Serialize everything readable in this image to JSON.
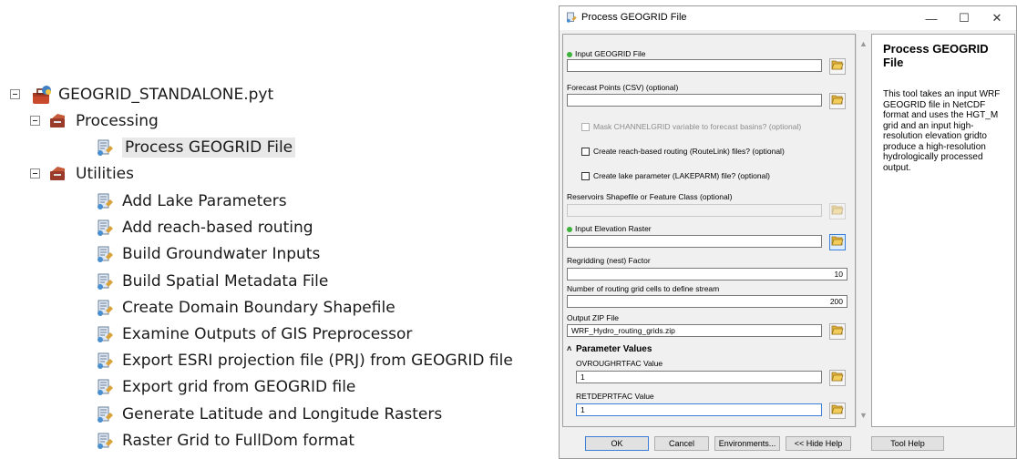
{
  "tree": {
    "toolbox": "GEOGRID_STANDALONE.pyt",
    "toolsets": [
      {
        "label": "Processing",
        "tools": [
          "Process GEOGRID File"
        ]
      },
      {
        "label": "Utilities",
        "tools": [
          "Add Lake Parameters",
          "Add reach-based routing",
          "Build Groundwater Inputs",
          "Build Spatial Metadata File",
          "Create Domain Boundary Shapefile",
          "Examine Outputs of GIS Preprocessor",
          "Export ESRI projection file (PRJ) from GEOGRID file",
          "Export grid from GEOGRID file",
          "Generate Latitude and Longitude Rasters",
          "Raster Grid to FullDom format"
        ]
      }
    ]
  },
  "dialog": {
    "title": "Process GEOGRID File",
    "window_buttons": {
      "minimize": "—",
      "maximize": "☐",
      "close": "✕"
    },
    "params": {
      "input_geogrid": {
        "label": "Input GEOGRID File",
        "value": ""
      },
      "forecast_points": {
        "label": "Forecast Points (CSV) (optional)",
        "value": ""
      },
      "mask_channelgrid": {
        "label": "Mask CHANNELGRID variable to forecast basins? (optional)"
      },
      "reach_routing": {
        "label": "Create reach-based routing (RouteLink) files? (optional)"
      },
      "lake_param": {
        "label": "Create lake parameter (LAKEPARM) file? (optional)"
      },
      "reservoirs": {
        "label": "Reservoirs Shapefile or Feature Class (optional)",
        "value": ""
      },
      "elevation": {
        "label": "Input Elevation Raster",
        "value": ""
      },
      "regridding": {
        "label": "Regridding (nest) Factor",
        "value": "10"
      },
      "routing_cells": {
        "label": "Number of routing grid cells to define stream",
        "value": "200"
      },
      "output_zip": {
        "label": "Output ZIP File",
        "value": "WRF_Hydro_routing_grids.zip"
      },
      "param_values": {
        "label": "Parameter Values"
      },
      "ovroughrtfac": {
        "label": "OVROUGHRTFAC Value",
        "value": "1"
      },
      "retdeprtfac": {
        "label": "RETDEPRTFAC Value",
        "value": "1"
      }
    },
    "help": {
      "title": "Process GEOGRID File",
      "text": "This tool takes an input WRF GEOGRID file in NetCDF format and uses the HGT_M grid and an input high-resolution elevation gridto produce a high-resolution hydrologically processed output."
    },
    "buttons": {
      "ok": "OK",
      "cancel": "Cancel",
      "environments": "Environments...",
      "hide_help": "<< Hide Help",
      "tool_help": "Tool Help"
    }
  },
  "colors": {
    "accent": "#3c7fd6",
    "required_dot": "#3bb23b"
  }
}
